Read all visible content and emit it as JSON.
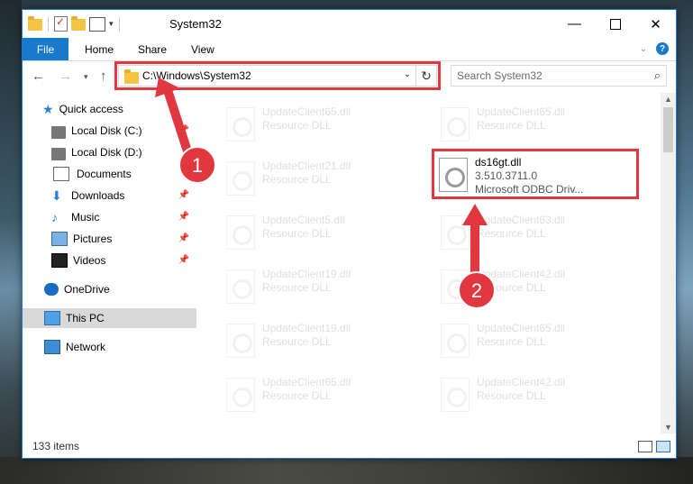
{
  "window": {
    "title": "System32",
    "tabs": [
      "File",
      "Home",
      "Share",
      "View"
    ]
  },
  "nav": {
    "address": "C:\\Windows\\System32",
    "search_placeholder": "Search System32"
  },
  "sidebar": {
    "items": [
      {
        "label": "Quick access",
        "icon": "star-icon"
      },
      {
        "label": "Local Disk (C:)",
        "icon": "drive-icon",
        "pinned": true
      },
      {
        "label": "Local Disk (D:)",
        "icon": "drive-icon"
      },
      {
        "label": "Documents",
        "icon": "documents-icon"
      },
      {
        "label": "Downloads",
        "icon": "download-icon",
        "pinned": true
      },
      {
        "label": "Music",
        "icon": "music-icon",
        "pinned": true
      },
      {
        "label": "Pictures",
        "icon": "pictures-icon",
        "pinned": true
      },
      {
        "label": "Videos",
        "icon": "videos-icon",
        "pinned": true
      },
      {
        "label": "OneDrive",
        "icon": "cloud-icon"
      },
      {
        "label": "This PC",
        "icon": "pc-icon",
        "selected": true
      },
      {
        "label": "Network",
        "icon": "network-icon"
      }
    ]
  },
  "files": [
    {
      "name": "UpdateClient65.dll",
      "desc": "Resource DLL"
    },
    {
      "name": "UpdateClient65.dll",
      "desc": "Resource DLL"
    },
    {
      "name": "UpdateClient21.dll",
      "desc": "Resource DLL"
    },
    {
      "name": "ds16gt.dll",
      "version": "3.510.3711.0",
      "desc": "Microsoft ODBC Driv...",
      "highlighted": true
    },
    {
      "name": "UpdateClient5.dll",
      "desc": "Resource DLL"
    },
    {
      "name": "UpdateClient63.dll",
      "desc": "Resource DLL"
    },
    {
      "name": "UpdateClient19.dll",
      "desc": "Resource DLL"
    },
    {
      "name": "UpdateClient42.dll",
      "desc": "Resource DLL"
    },
    {
      "name": "UpdateClient19.dll",
      "desc": "Resource DLL"
    },
    {
      "name": "UpdateClient65.dll",
      "desc": "Resource DLL"
    },
    {
      "name": "UpdateClient65.dll",
      "desc": "Resource DLL"
    },
    {
      "name": "UpdateClient42.dll",
      "desc": "Resource DLL"
    }
  ],
  "status": {
    "item_count": "133 items"
  },
  "annotations": {
    "badge1": "1",
    "badge2": "2",
    "accent": "#e0383e"
  }
}
